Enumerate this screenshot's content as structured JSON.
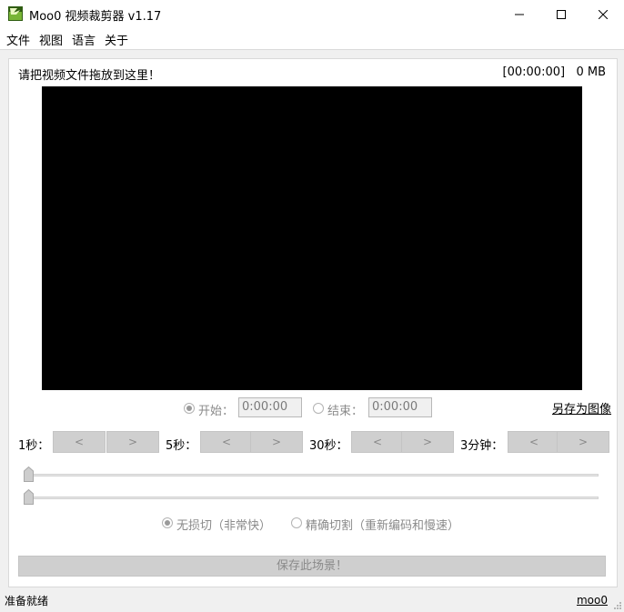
{
  "window": {
    "title": "Moo0 视频裁剪器 v1.17"
  },
  "menu": {
    "items": [
      "文件",
      "视图",
      "语言",
      "关于"
    ]
  },
  "main": {
    "drop_hint": "请把视频文件拖放到这里！",
    "time_info": "[00:00:00]   0 MB",
    "start_label": "开始：",
    "start_value": "0:00:00",
    "end_label": "结束：",
    "end_value": "0:00:00",
    "save_image_link": "另存为图像",
    "steps": [
      {
        "label": "1秒：",
        "prev": "<",
        "next": ">"
      },
      {
        "label": "5秒：",
        "prev": "<",
        "next": ">"
      },
      {
        "label": "30秒：",
        "prev": "<",
        "next": ">"
      },
      {
        "label": "3分钟：",
        "prev": "<",
        "next": ">"
      }
    ],
    "mode_lossless": "无损切（非常快）",
    "mode_precise": "精确切割（重新编码和慢速）",
    "save_button": "保存此场景！"
  },
  "status": {
    "text": "准备就绪",
    "link": "moo0"
  },
  "colors": {
    "video_bg": "#000000",
    "disabled_button": "#cfcfcf",
    "window_bg": "#f0f0f0"
  }
}
